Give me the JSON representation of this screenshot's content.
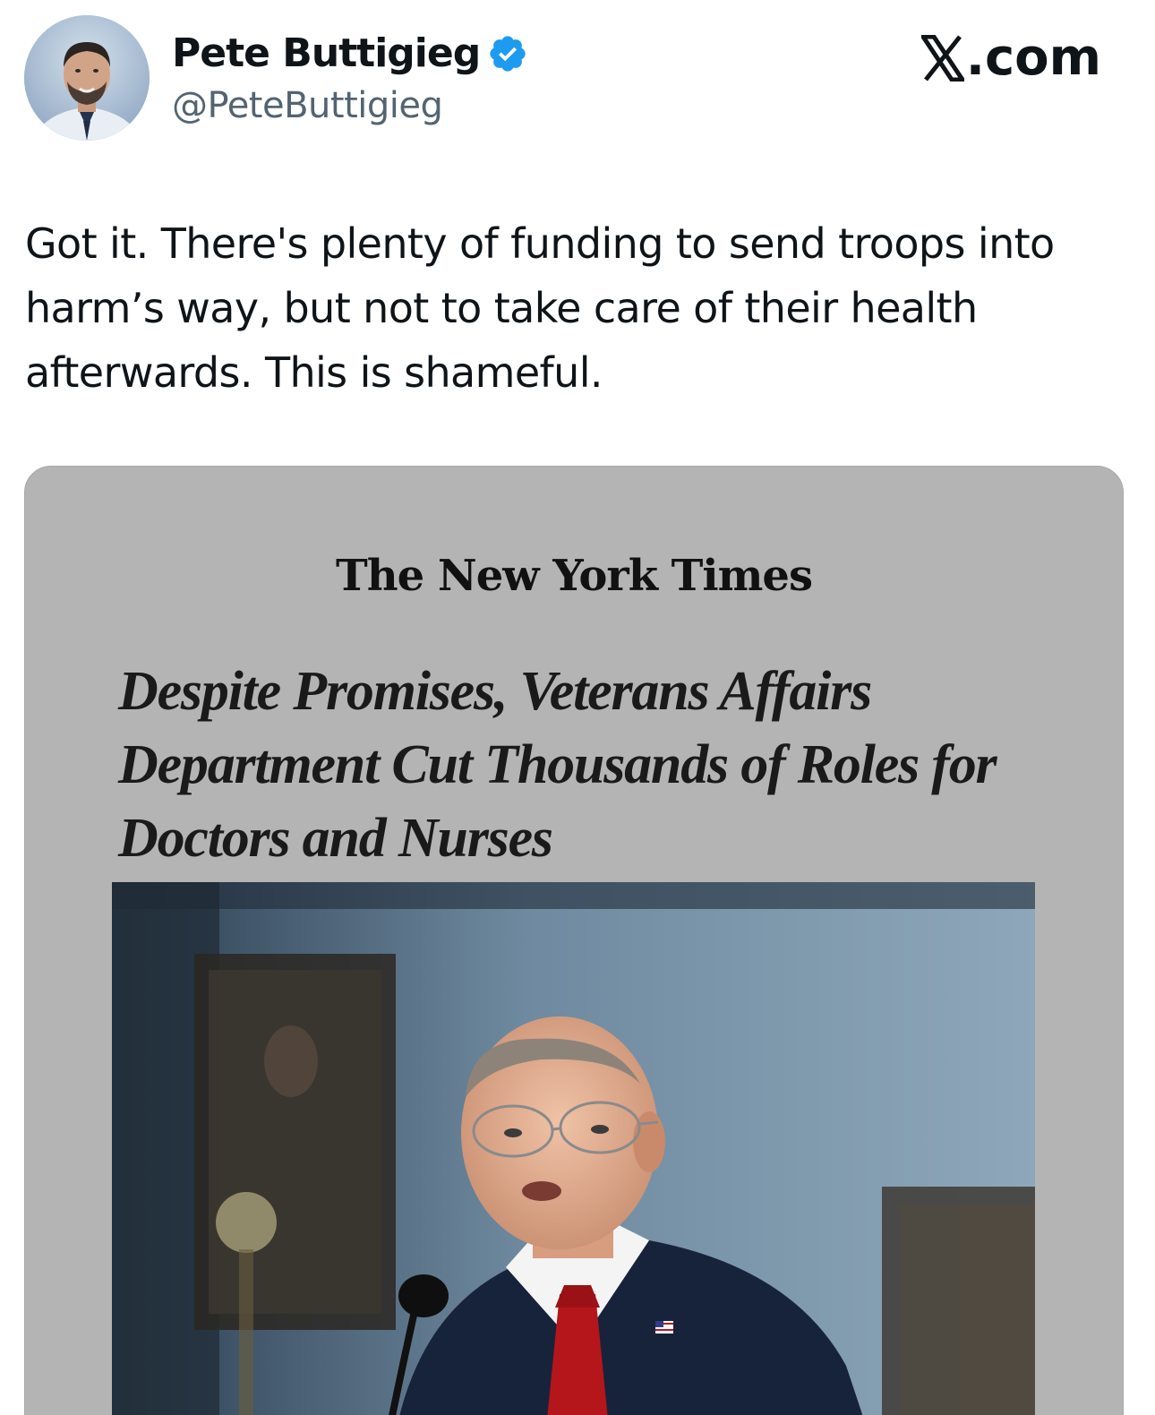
{
  "header": {
    "display_name": "Pete Buttigieg",
    "handle": "@PeteButtigieg",
    "verified": true,
    "avatar_icon": "profile-photo",
    "verified_icon": "verified-badge-icon",
    "site_label": ".com",
    "site_icon": "x-logo-icon"
  },
  "tweet": {
    "text": "Got it. There's plenty of funding to send troops into harm’s way, but not to take care of their health afterwards. This is shameful."
  },
  "media": {
    "publication": "The New York Times",
    "headline": "Despite Promises, Veterans Affairs Department Cut Thousands of Roles for Doctors and Nurses",
    "photo_icon": "news-photo-official-at-hearing"
  },
  "colors": {
    "text_primary": "#0f1419",
    "text_secondary": "#536471",
    "verified_blue": "#1d9bf0",
    "card_background": "#b4b4b4"
  }
}
